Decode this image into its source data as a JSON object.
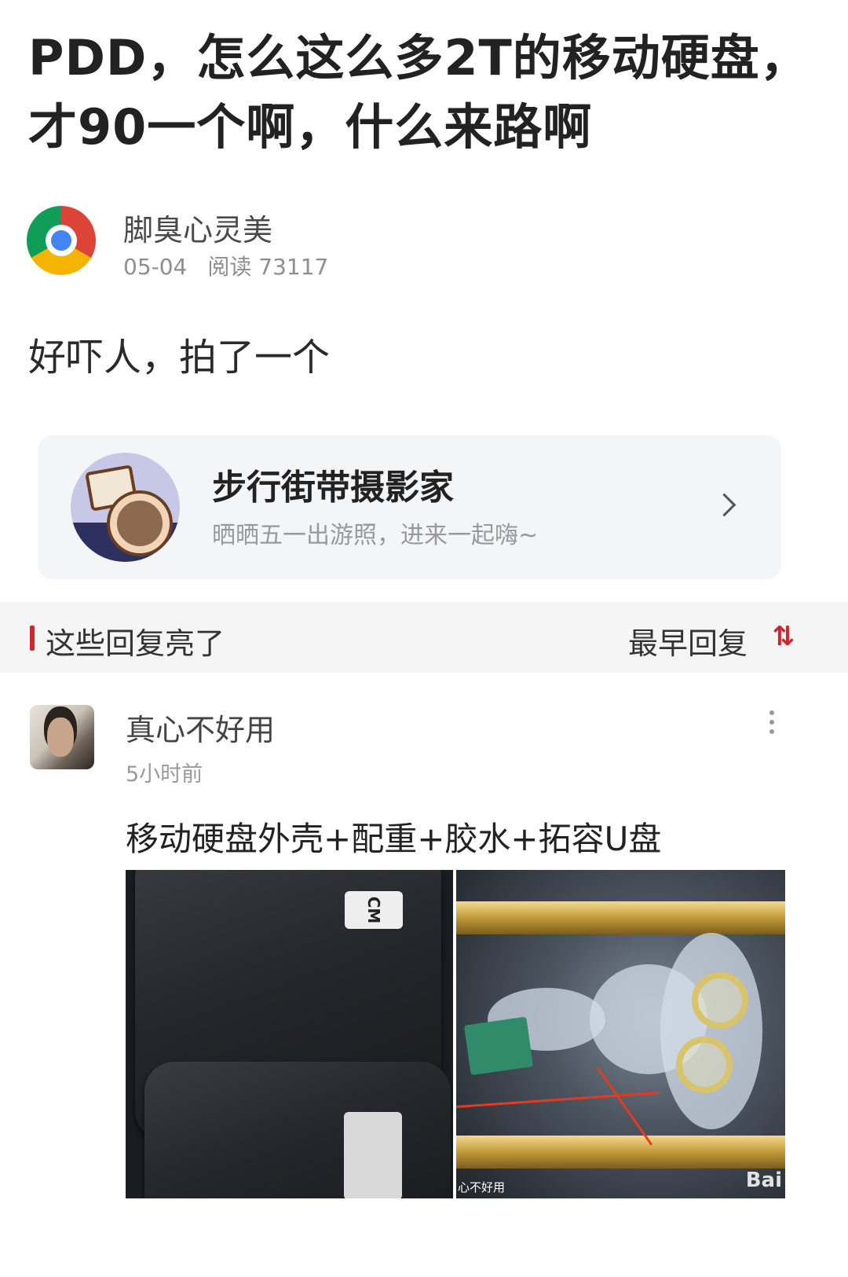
{
  "post": {
    "title": "PDD，怎么这么多2T的移动硬盘，才90一个啊，什么来路啊",
    "author": "脚臭心灵美",
    "date": "05-04",
    "reads": "阅读 73117",
    "body": "好吓人，拍了一个",
    "author_avatar_icon": "chrome-logo-icon"
  },
  "topic": {
    "title": "步行街带摄影家",
    "desc": "晒晒五一出游照，进来一起嗨~",
    "avatar_icon": "camera-illustration-icon"
  },
  "replies_bar": {
    "title": "这些回复亮了",
    "sort_label": "最早回复",
    "sort_icon_text": "⇅",
    "accent_color": "#d2242d"
  },
  "comment": {
    "user": "真心不好用",
    "time": "5小时前",
    "text": "移动硬盘外壳+配重+胶水+拓容U盘",
    "images": [
      {
        "name": "disk-photo-left",
        "overlay": "CM"
      },
      {
        "name": "disk-photo-right",
        "watermark_left": "心不好用",
        "watermark_right": "Bai"
      }
    ]
  }
}
